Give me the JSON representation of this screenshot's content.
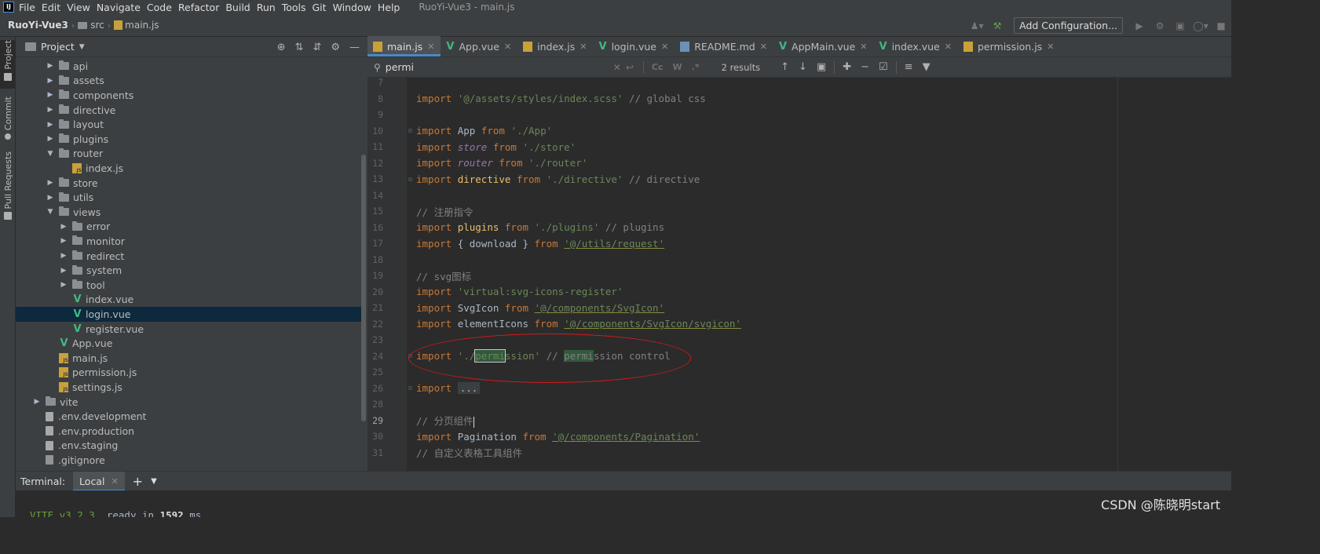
{
  "menu": {
    "logo": "IJ",
    "items": [
      "File",
      "Edit",
      "View",
      "Navigate",
      "Code",
      "Refactor",
      "Build",
      "Run",
      "Tools",
      "Git",
      "Window",
      "Help"
    ],
    "window_title": "RuoYi-Vue3 - main.js"
  },
  "breadcrumb": {
    "project": "RuoYi-Vue3",
    "folder": "src",
    "file": "main.js"
  },
  "toolbar": {
    "run_config_label": "Add Configuration..."
  },
  "left_stripe": {
    "project_label": "Project",
    "commit_label": "Commit",
    "pull_requests_label": "Pull Requests"
  },
  "project_panel": {
    "title": "Project",
    "tree": [
      {
        "label": "api",
        "type": "folder",
        "depth": 1,
        "expanded": false
      },
      {
        "label": "assets",
        "type": "folder",
        "depth": 1,
        "expanded": false
      },
      {
        "label": "components",
        "type": "folder",
        "depth": 1,
        "expanded": false
      },
      {
        "label": "directive",
        "type": "folder",
        "depth": 1,
        "expanded": false
      },
      {
        "label": "layout",
        "type": "folder",
        "depth": 1,
        "expanded": false
      },
      {
        "label": "plugins",
        "type": "folder",
        "depth": 1,
        "expanded": false
      },
      {
        "label": "router",
        "type": "folder",
        "depth": 1,
        "expanded": true
      },
      {
        "label": "index.js",
        "type": "js",
        "depth": 2
      },
      {
        "label": "store",
        "type": "folder",
        "depth": 1,
        "expanded": false
      },
      {
        "label": "utils",
        "type": "folder",
        "depth": 1,
        "expanded": false
      },
      {
        "label": "views",
        "type": "folder",
        "depth": 1,
        "expanded": true
      },
      {
        "label": "error",
        "type": "folder",
        "depth": 2,
        "expanded": false
      },
      {
        "label": "monitor",
        "type": "folder",
        "depth": 2,
        "expanded": false
      },
      {
        "label": "redirect",
        "type": "folder",
        "depth": 2,
        "expanded": false
      },
      {
        "label": "system",
        "type": "folder",
        "depth": 2,
        "expanded": false
      },
      {
        "label": "tool",
        "type": "folder",
        "depth": 2,
        "expanded": false
      },
      {
        "label": "index.vue",
        "type": "vue",
        "depth": 2
      },
      {
        "label": "login.vue",
        "type": "vue",
        "depth": 2,
        "selected": true
      },
      {
        "label": "register.vue",
        "type": "vue",
        "depth": 2
      },
      {
        "label": "App.vue",
        "type": "vue",
        "depth": 1
      },
      {
        "label": "main.js",
        "type": "js",
        "depth": 1
      },
      {
        "label": "permission.js",
        "type": "js",
        "depth": 1
      },
      {
        "label": "settings.js",
        "type": "js",
        "depth": 1
      },
      {
        "label": "vite",
        "type": "folder",
        "depth": 0,
        "expanded": false
      },
      {
        "label": ".env.development",
        "type": "file",
        "depth": 0
      },
      {
        "label": ".env.production",
        "type": "file",
        "depth": 0
      },
      {
        "label": ".env.staging",
        "type": "file",
        "depth": 0
      },
      {
        "label": ".gitignore",
        "type": "gitignore",
        "depth": 0
      }
    ]
  },
  "editor_tabs": [
    {
      "label": "main.js",
      "icon": "js",
      "active": true
    },
    {
      "label": "App.vue",
      "icon": "vue"
    },
    {
      "label": "index.js",
      "icon": "js"
    },
    {
      "label": "login.vue",
      "icon": "vue"
    },
    {
      "label": "README.md",
      "icon": "md"
    },
    {
      "label": "AppMain.vue",
      "icon": "vue"
    },
    {
      "label": "index.vue",
      "icon": "vue"
    },
    {
      "label": "permission.js",
      "icon": "js"
    }
  ],
  "search": {
    "value": "permi",
    "option_case": "Cc",
    "option_word": "W",
    "option_regex": ".*",
    "results": "2 results"
  },
  "code_lines": [
    {
      "n": "7",
      "tokens": []
    },
    {
      "n": "8",
      "tokens": [
        [
          "kw",
          "import "
        ],
        [
          "str",
          "'@/assets/styles/index.scss'"
        ],
        [
          "cm",
          " // global css"
        ]
      ]
    },
    {
      "n": "9",
      "tokens": []
    },
    {
      "n": "10",
      "fold": true,
      "tokens": [
        [
          "kw",
          "import "
        ],
        [
          "id",
          "App "
        ],
        [
          "kw",
          "from "
        ],
        [
          "str",
          "'./App'"
        ]
      ]
    },
    {
      "n": "11",
      "tokens": [
        [
          "kw",
          "import "
        ],
        [
          "purple",
          "store"
        ],
        [
          "kw",
          " from "
        ],
        [
          "str",
          "'./store'"
        ]
      ]
    },
    {
      "n": "12",
      "tokens": [
        [
          "kw",
          "import "
        ],
        [
          "purple",
          "router"
        ],
        [
          "kw",
          " from "
        ],
        [
          "str",
          "'./router'"
        ]
      ]
    },
    {
      "n": "13",
      "fold": true,
      "tokens": [
        [
          "kw",
          "import "
        ],
        [
          "idb",
          "directive"
        ],
        [
          "kw",
          " from "
        ],
        [
          "str",
          "'./directive'"
        ],
        [
          "cm",
          " // directive"
        ]
      ]
    },
    {
      "n": "14",
      "tokens": []
    },
    {
      "n": "15",
      "tokens": [
        [
          "cm",
          "// 注册指令"
        ]
      ]
    },
    {
      "n": "16",
      "tokens": [
        [
          "kw",
          "import "
        ],
        [
          "idb",
          "plugins"
        ],
        [
          "kw",
          " from "
        ],
        [
          "str",
          "'./plugins'"
        ],
        [
          "cm",
          " // plugins"
        ]
      ]
    },
    {
      "n": "17",
      "tokens": [
        [
          "kw",
          "import "
        ],
        [
          "id",
          "{ download } "
        ],
        [
          "kw",
          "from "
        ],
        [
          "link",
          "'@/utils/request'"
        ]
      ]
    },
    {
      "n": "18",
      "tokens": []
    },
    {
      "n": "19",
      "tokens": [
        [
          "cm",
          "// svg图标"
        ]
      ]
    },
    {
      "n": "20",
      "tokens": [
        [
          "kw",
          "import "
        ],
        [
          "str",
          "'virtual:svg-icons-register'"
        ]
      ]
    },
    {
      "n": "21",
      "tokens": [
        [
          "kw",
          "import "
        ],
        [
          "id",
          "SvgIcon "
        ],
        [
          "kw",
          "from "
        ],
        [
          "link",
          "'@/components/SvgIcon'"
        ]
      ]
    },
    {
      "n": "22",
      "tokens": [
        [
          "kw",
          "import "
        ],
        [
          "id",
          "elementIcons "
        ],
        [
          "kw",
          "from "
        ],
        [
          "link",
          "'@/components/SvgIcon/svgicon'"
        ]
      ]
    },
    {
      "n": "23",
      "tokens": []
    },
    {
      "n": "24",
      "fold": true,
      "tokens": [
        [
          "kw",
          "import "
        ],
        [
          "str",
          "'./"
        ],
        [
          "hlbox",
          "permi"
        ],
        [
          "str",
          "ssion'"
        ],
        [
          "cm",
          " // "
        ],
        [
          "hlcm",
          "permi"
        ],
        [
          "cm",
          "ssion control"
        ]
      ]
    },
    {
      "n": "25",
      "tokens": []
    },
    {
      "n": "26",
      "fold": true,
      "tokens": [
        [
          "kw",
          "import "
        ],
        [
          "folded",
          "..."
        ]
      ]
    },
    {
      "n": "28",
      "tokens": []
    },
    {
      "n": "29",
      "current": true,
      "tokens": [
        [
          "cm",
          "// 分页组件"
        ],
        [
          "caret",
          ""
        ]
      ]
    },
    {
      "n": "30",
      "tokens": [
        [
          "kw",
          "import "
        ],
        [
          "id",
          "Pagination "
        ],
        [
          "kw",
          "from "
        ],
        [
          "link",
          "'@/components/Pagination'"
        ]
      ]
    },
    {
      "n": "31",
      "tokens": [
        [
          "cm",
          "// 自定义表格工具组件"
        ]
      ]
    }
  ],
  "terminal": {
    "title": "Terminal:",
    "tab_label": "Local",
    "line_vite": "VITE v3.2.3",
    "line_ready": "  ready in ",
    "line_ms": "1592",
    "line_ms_unit": " ms"
  },
  "watermark": "CSDN @陈晓明start",
  "colors": {
    "annotation": "#d21a1a",
    "selection": "#0d293e",
    "match_highlight": "#32593d",
    "active_tab_underline": "#4a88c7"
  }
}
